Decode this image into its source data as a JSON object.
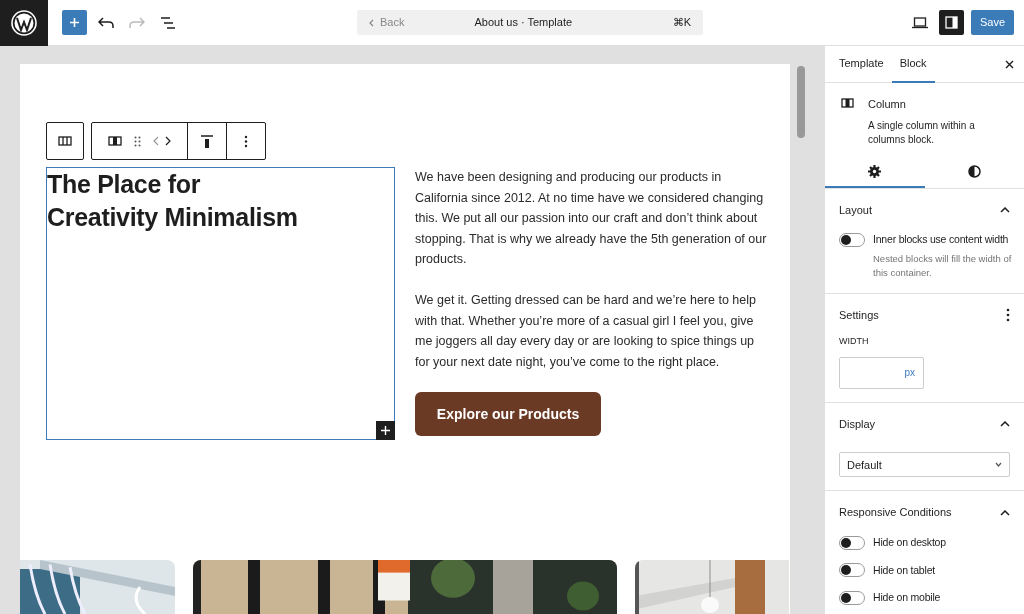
{
  "top_bar": {
    "back": "Back",
    "title": "About us · Template",
    "shortcut": "⌘K",
    "save": "Save",
    "sidebar_toggle_on": true
  },
  "content": {
    "heading_lines": [
      "The Place for",
      "Creativity Minimalism"
    ],
    "paragraphs": [
      "We have been designing and producing our products in California since 2012. At no time have we considered changing this. We put all our passion into our craft and don’t think about stopping. That is why we already have the 5th generation of our products.",
      "We get it. Getting dressed can be hard and we’re here to help with that. Whether you’re more of a casual girl I feel you, give me joggers all day every day or are looking to spice things up for your next date night, you’ve come to the right place."
    ],
    "cta": "Explore our Products",
    "photos": [
      {
        "kind": "picture"
      },
      {
        "kind": "picture"
      },
      {
        "kind": "picture"
      }
    ]
  },
  "sidebar": {
    "tabs": [
      {
        "label": "Template",
        "selected": false
      },
      {
        "label": "Block",
        "selected": true
      }
    ],
    "block": {
      "name": "Column",
      "description": "A single column within a columns block."
    },
    "icon_tabs": [
      {
        "kind": "settings",
        "selected": true
      },
      {
        "kind": "styles",
        "selected": false
      }
    ],
    "sections": [
      {
        "kind": "toggles",
        "title": "Layout",
        "expanded": true,
        "toggles": [
          {
            "label": "Inner blocks use content width",
            "on": false,
            "help": "Nested blocks will fill the width of this container."
          }
        ]
      },
      {
        "kind": "width",
        "title": "Settings",
        "field_label": "WIDTH",
        "unit": "px"
      },
      {
        "kind": "select",
        "title": "Display",
        "expanded": true,
        "value": "Default"
      },
      {
        "kind": "toggles",
        "title": "Responsive Conditions",
        "expanded": true,
        "toggles": [
          {
            "label": "Hide on desktop",
            "on": false
          },
          {
            "label": "Hide on tablet",
            "on": false
          },
          {
            "label": "Hide on mobile",
            "on": false
          }
        ]
      }
    ]
  }
}
